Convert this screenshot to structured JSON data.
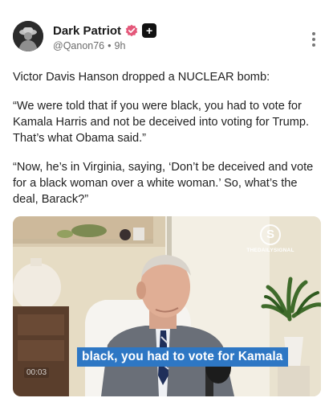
{
  "author": {
    "name": "Dark Patriot",
    "handle": "@Qanon76",
    "separator": "•",
    "time": "9h",
    "plus_badge": "+"
  },
  "icons": {
    "verified": "verified-badge-icon",
    "more": "more-vertical-icon"
  },
  "colors": {
    "verified_badge": "#e4587a",
    "caption_bg": "#2e77c4"
  },
  "post": {
    "paragraphs": [
      "Victor Davis Hanson dropped a NUCLEAR bomb:",
      "“We were told that if you were black, you had to vote for Kamala Harris and not be deceived into voting for Trump. That’s what Obama said.”",
      "“Now, he’s in Virginia, saying, ‘Don’t be deceived and vote for a black woman over a white woman.’ So, what’s the deal, Barack?”"
    ]
  },
  "media": {
    "logo_letter": "S",
    "logo_text": "THEDAILYSIGNAL",
    "caption": "black, you had to vote for Kamala",
    "timestamp": "00:03"
  }
}
